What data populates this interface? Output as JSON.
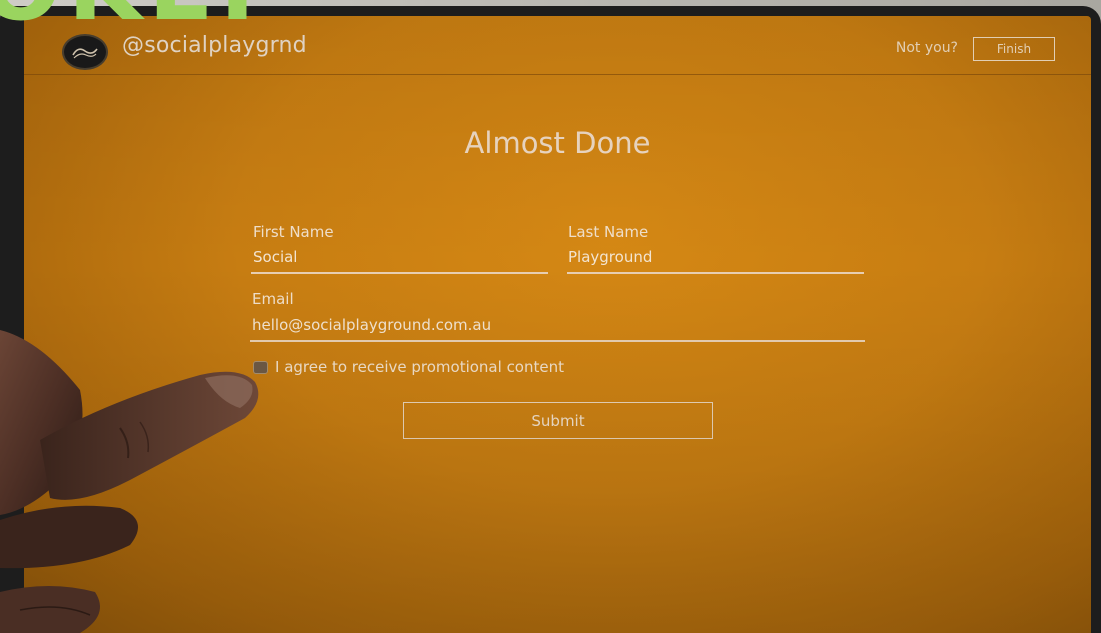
{
  "overlay": {
    "text": "OKEI"
  },
  "header": {
    "handle": "@socialplaygrnd",
    "not_you": "Not you?",
    "finish_label": "Finish"
  },
  "form": {
    "title": "Almost Done",
    "first_name": {
      "label": "First Name",
      "value": "Social"
    },
    "last_name": {
      "label": "Last Name",
      "value": "Playground"
    },
    "email": {
      "label": "Email",
      "value": "hello@socialplayground.com.au"
    },
    "agree_label": "I agree to receive promotional content",
    "submit_label": "Submit"
  },
  "colors": {
    "screen": "#c77d12",
    "overlay_text": "#9ad45f",
    "bezel": "#1d1d1d"
  }
}
